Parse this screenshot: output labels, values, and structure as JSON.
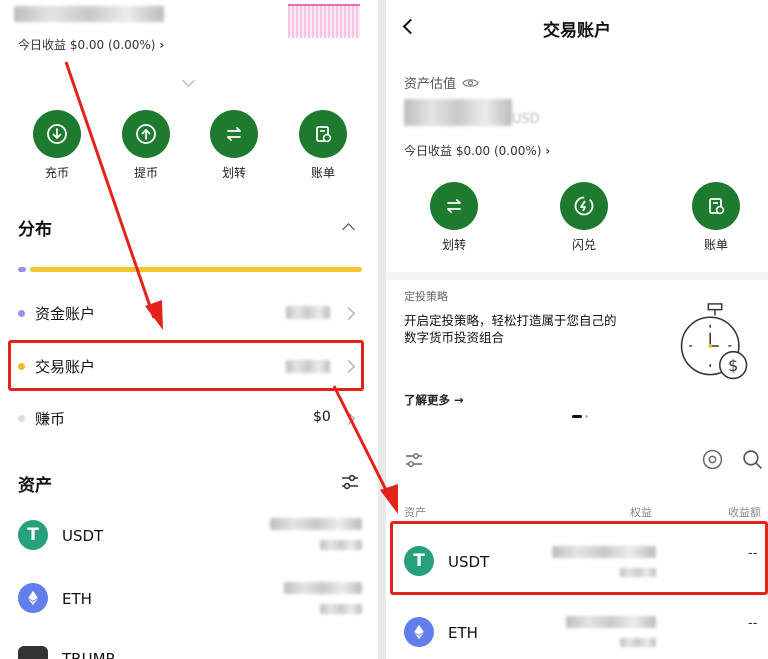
{
  "left": {
    "today_earnings": "今日收益 $0.00 (0.00%)",
    "actions": [
      {
        "label": "充币",
        "icon": "deposit-icon"
      },
      {
        "label": "提币",
        "icon": "withdraw-icon"
      },
      {
        "label": "划转",
        "icon": "transfer-icon"
      },
      {
        "label": "账单",
        "icon": "bill-icon"
      }
    ],
    "distribution_title": "分布",
    "accounts": [
      {
        "label": "资金账户",
        "dot_color": "#9b8ee8"
      },
      {
        "label": "交易账户",
        "dot_color": "#f3b72a"
      },
      {
        "label": "赚币",
        "dot_color": "#dddddd",
        "value": "$0"
      }
    ],
    "assets_title": "资产",
    "assets": [
      {
        "symbol": "USDT",
        "icon": "tether-icon",
        "color": "#26a17b"
      },
      {
        "symbol": "ETH",
        "icon": "ethereum-icon",
        "color": "#627eea"
      },
      {
        "symbol": "TRUMP",
        "icon": "trump-coin-icon",
        "color": "#333333"
      }
    ]
  },
  "right": {
    "title": "交易账户",
    "valuation_label": "资产估值",
    "valuation_unit": "USD",
    "today_earnings": "今日收益 $0.00 (0.00%)",
    "actions": [
      {
        "label": "划转",
        "icon": "transfer-icon"
      },
      {
        "label": "闪兑",
        "icon": "flash-swap-icon"
      },
      {
        "label": "账单",
        "icon": "bill-icon"
      }
    ],
    "banner": {
      "tag": "定投策略",
      "text_line1": "开启定投策略，轻松打造属于您自己的",
      "text_line2": "数字货币投资组合",
      "link": "了解更多 →"
    },
    "table_headers": {
      "asset": "资产",
      "equity": "权益",
      "pnl": "收益额"
    },
    "assets": [
      {
        "symbol": "USDT",
        "icon": "tether-icon",
        "color": "#26a17b",
        "pnl": "--"
      },
      {
        "symbol": "ETH",
        "icon": "ethereum-icon",
        "color": "#627eea",
        "pnl": "--"
      }
    ]
  },
  "colors": {
    "accent_green": "#1e7a2e",
    "highlight_red": "#e3231b",
    "bar_yellow": "#f3c52f"
  }
}
